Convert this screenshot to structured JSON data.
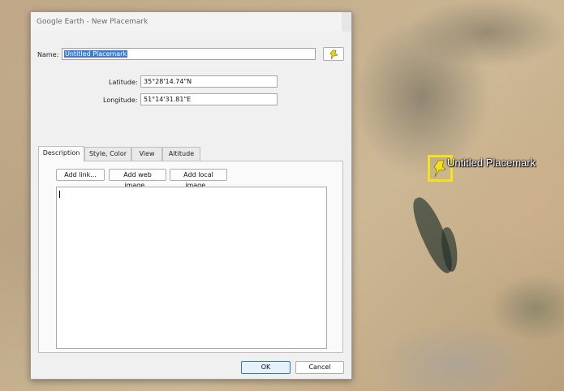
{
  "dialog": {
    "title": "Google Earth - New Placemark",
    "name_label": "Name:",
    "name_value": "Untitled Placemark",
    "latitude_label": "Latitude:",
    "latitude_value": "35°28'14.74\"N",
    "longitude_label": "Longitude:",
    "longitude_value": "51°14'31.81\"E",
    "tabs": [
      {
        "label": "Description",
        "active": true
      },
      {
        "label": "Style, Color",
        "active": false
      },
      {
        "label": "View",
        "active": false
      },
      {
        "label": "Altitude",
        "active": false
      }
    ],
    "desc_buttons": {
      "add_link": "Add link...",
      "add_web_image": "Add web image...",
      "add_local_image": "Add local image..."
    },
    "description_text": "",
    "ok_label": "OK",
    "cancel_label": "Cancel"
  },
  "map": {
    "placemark_label": "Untitled Placemark",
    "placemark_color": "#f3e21b"
  }
}
